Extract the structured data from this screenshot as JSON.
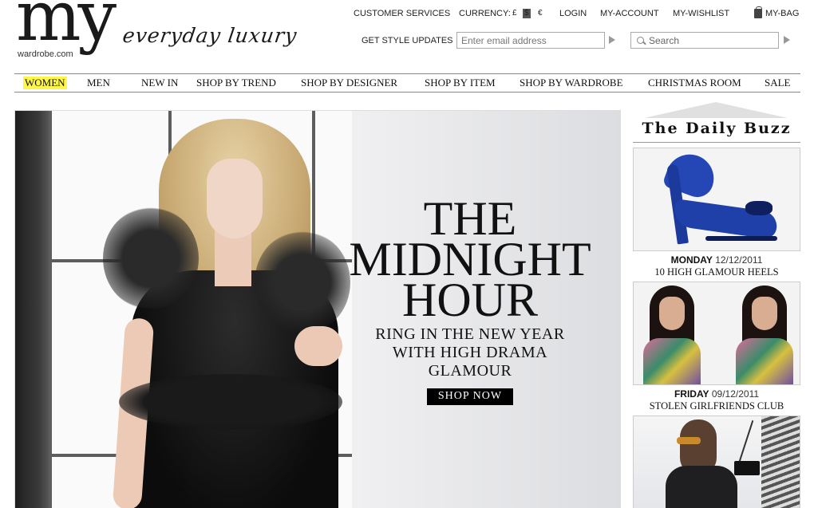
{
  "logo": {
    "brand": "my",
    "domain": "wardrobe.com",
    "tagline": "everyday luxury"
  },
  "utility": {
    "customer_services": "CUSTOMER SERVICES",
    "currency_label": "CURRENCY:",
    "currency_options": [
      "£",
      "$",
      "€"
    ],
    "currency_selected": "$",
    "login": "LOGIN",
    "account": "MY-ACCOUNT",
    "wishlist": "MY-WISHLIST",
    "bag": "MY-BAG"
  },
  "newsletter": {
    "label": "GET STYLE UPDATES",
    "placeholder": "Enter email address"
  },
  "search": {
    "placeholder": "Search"
  },
  "nav": {
    "items": [
      "WOMEN",
      "MEN",
      "NEW IN",
      "SHOP BY TREND",
      "SHOP BY DESIGNER",
      "SHOP BY ITEM",
      "SHOP BY WARDROBE",
      "CHRISTMAS ROOM",
      "SALE"
    ],
    "active": "WOMEN"
  },
  "hero": {
    "title_line1": "THE",
    "title_line2": "MIDNIGHT",
    "title_line3": "HOUR",
    "sub_line1": "RING IN THE NEW YEAR",
    "sub_line2": "WITH HIGH DRAMA",
    "sub_line3": "GLAMOUR",
    "cta": "SHOP NOW"
  },
  "buzz": {
    "title": "The Daily Buzz",
    "entries": [
      {
        "day": "MONDAY",
        "date": "12/12/2011",
        "caption": "10 HIGH GLAMOUR HEELS",
        "image": "blue-heel-image"
      },
      {
        "day": "FRIDAY",
        "date": "09/12/2011",
        "caption": "STOLEN GIRLFRIENDS CLUB",
        "image": "two-models-image"
      },
      {
        "day": "",
        "date": "",
        "caption": "",
        "image": "street-style-image"
      }
    ]
  },
  "colors": {
    "nav_highlight": "#fff64a",
    "cta_bg": "#000000",
    "shoe_blue": "#1f40a8"
  }
}
